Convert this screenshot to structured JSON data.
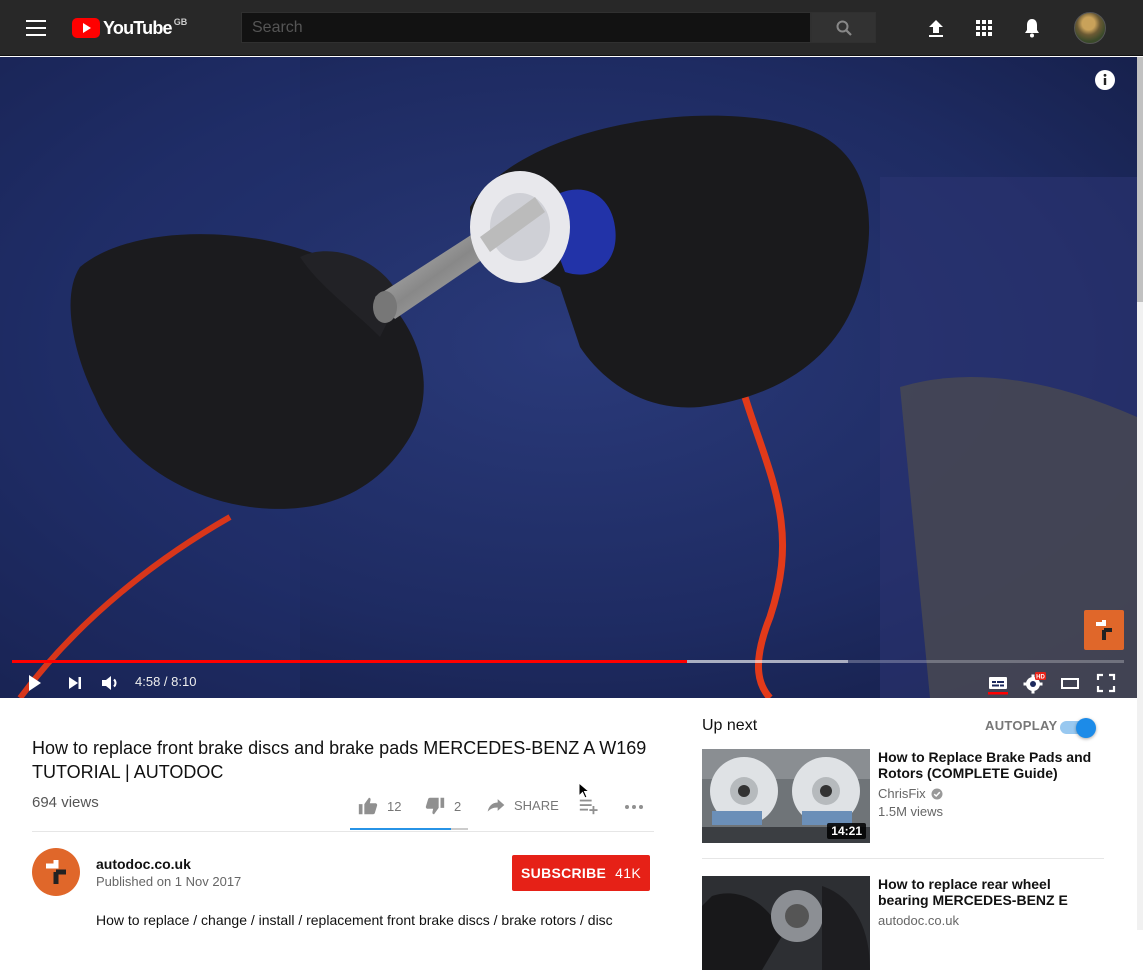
{
  "masthead": {
    "logo_text": "YouTube",
    "logo_region": "GB",
    "search_placeholder": "Search"
  },
  "player": {
    "current_time": "4:58",
    "duration": "8:10",
    "time_display": "4:58 / 8:10",
    "played_fraction": 0.607,
    "buffered_fraction": 0.752,
    "hd_badge": "HD"
  },
  "video": {
    "title": "How to replace front brake discs and brake pads MERCEDES-BENZ A W169 TUTORIAL | AUTODOC",
    "views": "694 views",
    "likes": "12",
    "dislikes": "2",
    "like_fraction": 0.857,
    "share_label": "SHARE"
  },
  "channel": {
    "name": "autodoc.co.uk",
    "published": "Published on 1 Nov 2017",
    "subscribe_label": "SUBSCRIBE",
    "subscriber_count": "41K",
    "description": "How to replace / change / install / replacement front brake discs / brake rotors / disc"
  },
  "sidebar": {
    "up_next_label": "Up next",
    "autoplay_label": "AUTOPLAY",
    "autoplay_on": true,
    "recommendations": [
      {
        "title": "How to Replace Brake Pads and Rotors (COMPLETE Guide)",
        "channel": "ChrisFix",
        "verified": true,
        "views": "1.5M views",
        "duration": "14:21"
      },
      {
        "title": "How to replace rear wheel bearing MERCEDES-BENZ E",
        "channel": "autodoc.co.uk"
      }
    ]
  },
  "colors": {
    "brand_red": "#ff0000",
    "subscribe_red": "#e62117",
    "masthead_bg": "#282828",
    "autoplay_blue": "#1c8be8",
    "channel_orange": "#e0672a"
  }
}
